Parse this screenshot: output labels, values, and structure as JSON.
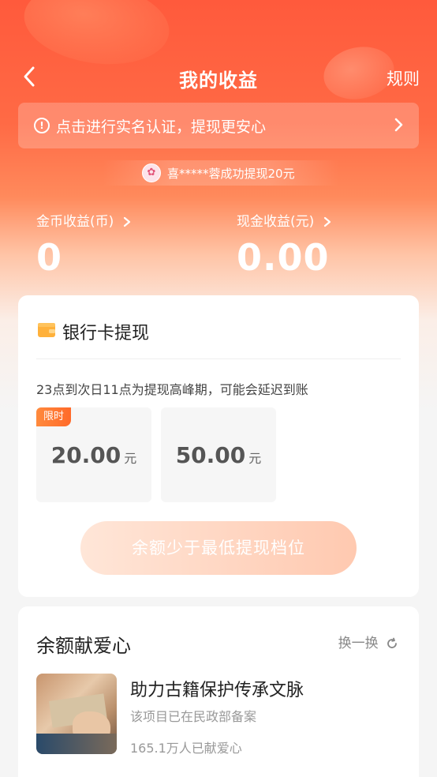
{
  "header": {
    "title": "我的收益",
    "rules_label": "规则"
  },
  "notice": {
    "icon": "!",
    "text": "点击进行实名认证，提现更安心"
  },
  "ticker": {
    "text": "喜*****蓉成功提现20元"
  },
  "earnings": {
    "coin_label": "金币收益(币)",
    "coin_value": "0",
    "cash_label": "现金收益(元)",
    "cash_value": "0.00"
  },
  "bank_card": {
    "title": "银行卡提现",
    "peak_note": "23点到次日11点为提现高峰期，可能会延迟到账",
    "options": [
      {
        "amount": "20.00",
        "unit": "元",
        "badge": "限时"
      },
      {
        "amount": "50.00",
        "unit": "元"
      }
    ],
    "withdraw_button": "余额少于最低提现档位"
  },
  "charity": {
    "title": "余额献爱心",
    "swap_label": "换一换",
    "project": {
      "title": "助力古籍保护传承文脉",
      "subtitle": "该项目已在民政部备案",
      "count": "165.1万人已献爱心"
    }
  },
  "colors": {
    "accent": "#ff5a3c",
    "badge": "#ff7a30",
    "button_disabled": "#ffc9b0"
  }
}
